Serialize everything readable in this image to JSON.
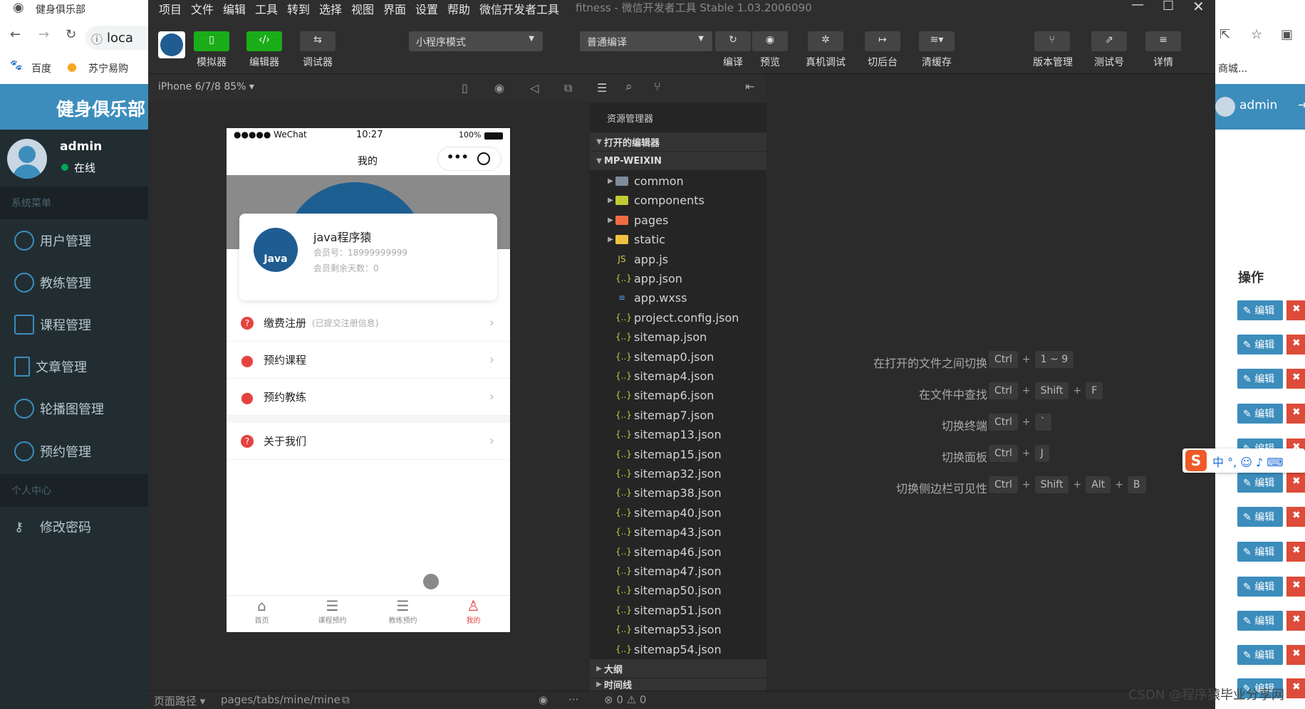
{
  "browser": {
    "tab_title": "健身俱乐部",
    "address_partial": "loca",
    "bookmarks": [
      "百度",
      "苏宁易购"
    ],
    "right_bookmark": "商城..."
  },
  "admin_app": {
    "brand": "健身俱乐部",
    "user_name": "admin",
    "user_status": "在线",
    "section_system": "系统菜单",
    "section_personal": "个人中心",
    "menu": [
      {
        "label": "用户管理",
        "icon": "user-icon"
      },
      {
        "label": "教练管理",
        "icon": "coach-icon"
      },
      {
        "label": "课程管理",
        "icon": "calendar-icon"
      },
      {
        "label": "文章管理",
        "icon": "document-icon"
      },
      {
        "label": "轮播图管理",
        "icon": "carousel-icon"
      },
      {
        "label": "预约管理",
        "icon": "clock-icon"
      }
    ],
    "personal_menu": [
      {
        "label": "修改密码",
        "icon": "key-icon"
      }
    ],
    "topbar_user": "admin",
    "ops_header": "操作",
    "edit_label": "编辑",
    "delete_label": "✖"
  },
  "devtools": {
    "window_title": "fitness - 微信开发者工具 Stable 1.03.2006090",
    "menu": [
      "项目",
      "文件",
      "编辑",
      "工具",
      "转到",
      "选择",
      "视图",
      "界面",
      "设置",
      "帮助",
      "微信开发者工具"
    ],
    "toolbar": {
      "simulator": "模拟器",
      "editor": "编辑器",
      "debugger": "调试器",
      "mode_select": "小程序模式",
      "compile_select": "普通编译",
      "compile": "编译",
      "preview": "预览",
      "real_debug": "真机调试",
      "background": "切后台",
      "clear_cache": "清缓存",
      "version": "版本管理",
      "test_id": "测试号",
      "details": "详情"
    },
    "device": "iPhone 6/7/8 85% ▾",
    "explorer": {
      "title": "资源管理器",
      "open_editors": "打开的编辑器",
      "root": "MP-WEIXIN",
      "folders": [
        {
          "name": "common",
          "color": "#7e8c9a"
        },
        {
          "name": "components",
          "color": "#c0ca33"
        },
        {
          "name": "pages",
          "color": "#ef6c42"
        },
        {
          "name": "static",
          "color": "#f0c040"
        }
      ],
      "files": [
        {
          "name": "app.js",
          "icon": "JS"
        },
        {
          "name": "app.json",
          "icon": "{..}"
        },
        {
          "name": "app.wxss",
          "icon": "≡"
        },
        {
          "name": "project.config.json",
          "icon": "{..}"
        },
        {
          "name": "sitemap.json",
          "icon": "{..}"
        },
        {
          "name": "sitemap0.json",
          "icon": "{..}"
        },
        {
          "name": "sitemap4.json",
          "icon": "{..}"
        },
        {
          "name": "sitemap6.json",
          "icon": "{..}"
        },
        {
          "name": "sitemap7.json",
          "icon": "{..}"
        },
        {
          "name": "sitemap13.json",
          "icon": "{..}"
        },
        {
          "name": "sitemap15.json",
          "icon": "{..}"
        },
        {
          "name": "sitemap32.json",
          "icon": "{..}"
        },
        {
          "name": "sitemap38.json",
          "icon": "{..}"
        },
        {
          "name": "sitemap40.json",
          "icon": "{..}"
        },
        {
          "name": "sitemap43.json",
          "icon": "{..}"
        },
        {
          "name": "sitemap46.json",
          "icon": "{..}"
        },
        {
          "name": "sitemap47.json",
          "icon": "{..}"
        },
        {
          "name": "sitemap50.json",
          "icon": "{..}"
        },
        {
          "name": "sitemap51.json",
          "icon": "{..}"
        },
        {
          "name": "sitemap53.json",
          "icon": "{..}"
        },
        {
          "name": "sitemap54.json",
          "icon": "{..}"
        }
      ],
      "outline": "大纲",
      "timeline": "时间线"
    },
    "shortcuts": [
      {
        "label": "在打开的文件之间切换",
        "keys": [
          "Ctrl",
          "1 ~ 9"
        ]
      },
      {
        "label": "在文件中查找",
        "keys": [
          "Ctrl",
          "Shift",
          "F"
        ]
      },
      {
        "label": "切换终端",
        "keys": [
          "Ctrl",
          "`"
        ]
      },
      {
        "label": "切换面板",
        "keys": [
          "Ctrl",
          "J"
        ]
      },
      {
        "label": "切换侧边栏可见性",
        "keys": [
          "Ctrl",
          "Shift",
          "Alt",
          "B"
        ]
      }
    ],
    "status": {
      "page_path_label": "页面路径 ▾",
      "page_path": "pages/tabs/mine/mine",
      "problems": "⊗ 0 ⚠ 0"
    }
  },
  "phone": {
    "carrier": "●●●●● WeChat",
    "time": "10:27",
    "battery": "100%",
    "nav_title": "我的",
    "member_name": "java程序猿",
    "member_no": "会员号：18999999999",
    "member_days": "会员剩余天数：0",
    "logo_text": "Java",
    "rows": [
      {
        "label": "缴费注册",
        "note": "(已提交注册信息)",
        "icon": "question-icon"
      },
      {
        "label": "预约课程",
        "note": "",
        "icon": "location-icon"
      },
      {
        "label": "预约教练",
        "note": "",
        "icon": "location-icon"
      },
      {
        "label": "关于我们",
        "note": "",
        "icon": "question-icon"
      }
    ],
    "tabs": [
      {
        "label": "首页",
        "icon": "home-icon"
      },
      {
        "label": "课程预约",
        "icon": "list-icon"
      },
      {
        "label": "教练预约",
        "icon": "list-icon"
      },
      {
        "label": "我的",
        "icon": "person-icon"
      }
    ]
  },
  "watermark": "CSDN @程序猿毕业分享网"
}
